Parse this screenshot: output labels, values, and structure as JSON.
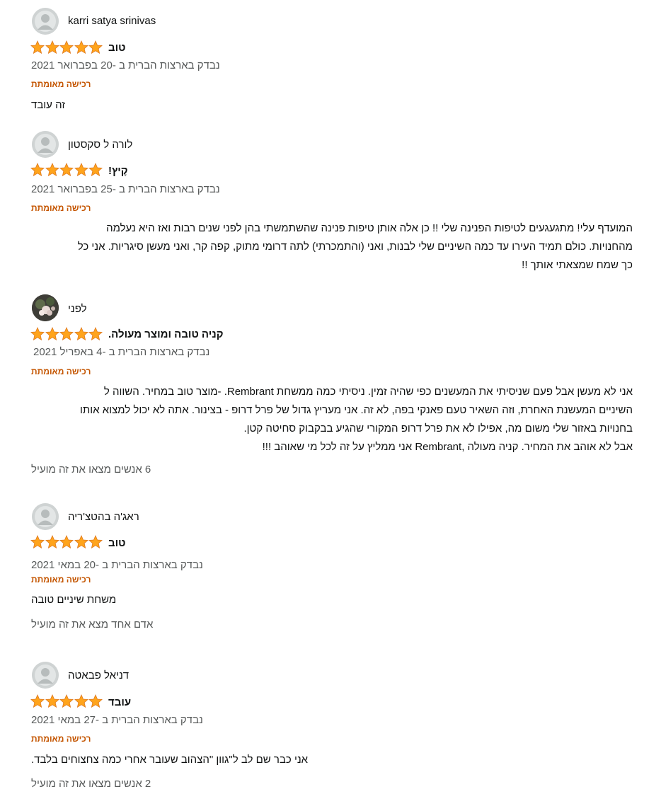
{
  "colors": {
    "star": "#ffa41c",
    "verified": "#c45500",
    "meta": "#565959"
  },
  "icons": {
    "avatar_default": "user-silhouette-icon",
    "avatar_photo": "profile-photo-icon",
    "star": "star-icon"
  },
  "reviews": [
    {
      "author": "karri satya srinivas",
      "rating": 5,
      "title": "טוב",
      "meta": "נבדק בארצות הברית ב -20 בפברואר 2021",
      "verified": "רכישה מאומתת",
      "body": "זה עובד",
      "helpful": ""
    },
    {
      "author": "לורה ל סקסטון",
      "rating": 5,
      "title": "קֶיץ!",
      "meta": "נבדק בארצות הברית ב -25 בפברואר 2021",
      "verified": "רכישה מאומתת",
      "body": "המועדף עלי! מתגעגעים לטיפות הפנינה שלי !! כן אלה אותן טיפות פנינה שהשתמשתי בהן לפני שנים רבות ואז היא נעלמה\nמהחנויות. כולם תמיד העירו עד כמה השיניים שלי לבנות, ואני (והתמכרתי) לתה דרומי מתוק, קפה קר, ואני מעשן סיגריות. אני כל\nכך שמח שמצאתי אותך !!",
      "helpful": ""
    },
    {
      "author": "לפני",
      "rating": 5,
      "title": "קניה טובה ומוצר מעולה.",
      "meta": "נבדק בארצות הברית ב -4 באפריל 2021",
      "verified": "רכישה מאומתת",
      "body": "אני לא מעשן אבל פעם שניסיתי את המעשנים כפי שהיה זמין. ניסיתי כמה ממשחת Rembrant. -מוצר טוב במחיר. השווה ל\nהשיניים המעשנת האחרת, וזה השאיר טעם פאנקי בפה, לא זה. אני מעריץ גדול של פרל דרופ - בצינור. אתה לא יכול למצוא אותו\nבחנויות באזור שלי משום מה, אפילו לא את פרל דרופ המקורי שהגיע בבקבוק סחיטה קטן.\nאבל לא אוהב את המחיר. קניה מעולה ,Rembrant אני ממליץ על זה לכל מי שאוהב !!!",
      "helpful": "6 אנשים מצאו את זה מועיל"
    },
    {
      "author": "ראג'ה בהטצ'ריה",
      "rating": 5,
      "title": "טוב",
      "meta": "נבדק בארצות הברית ב -20 במאי 2021",
      "verified": "רכישה מאומתת",
      "body": "משחת שיניים טובה",
      "helpful": "אדם אחד מצא את זה מועיל"
    },
    {
      "author": "דניאל פבאטה",
      "rating": 5,
      "title": "עובד",
      "meta": "נבדק בארצות הברית ב -27 במאי 2021",
      "verified": "רכישה מאומתת",
      "body": "אני כבר שם לב ל\"גוון \"הצהוב שעובר אחרי כמה צחצוחים בלבד.",
      "helpful": "2 אנשים מצאו את זה מועיל"
    }
  ]
}
